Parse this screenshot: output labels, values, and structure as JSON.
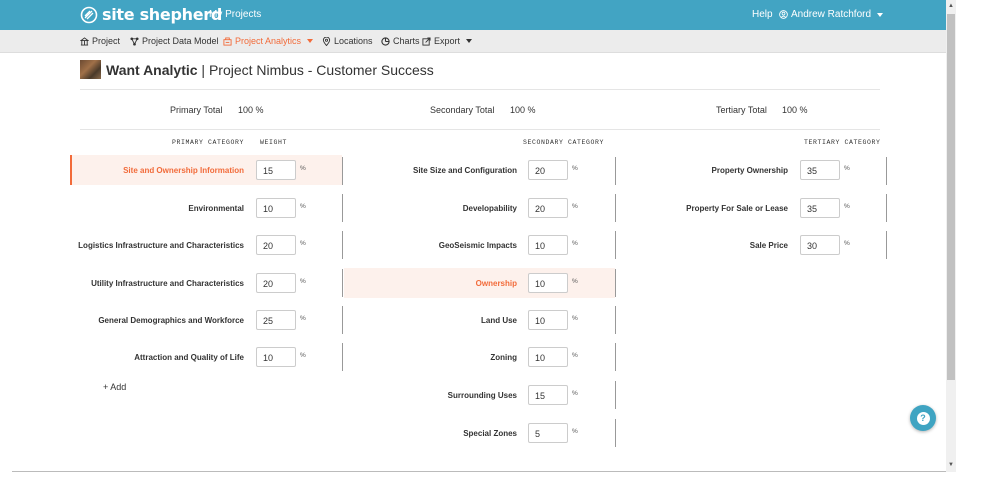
{
  "topbar": {
    "brand": "site shepherd",
    "nav_link": "My Projects",
    "help": "Help",
    "user": "Andrew Ratchford"
  },
  "subnav": {
    "items": [
      "Project",
      "Project Data Model",
      "Project Analytics",
      "Locations",
      "Charts",
      "Export"
    ]
  },
  "page": {
    "title_bold": "Want Analytic",
    "title_rest": " | Project Nimbus - Customer Success"
  },
  "totals": {
    "primary_label": "Primary Total",
    "primary_value": "100 %",
    "secondary_label": "Secondary Total",
    "secondary_value": "100 %",
    "tertiary_label": "Tertiary Total",
    "tertiary_value": "100 %"
  },
  "headers": {
    "primary": "PRIMARY CATEGORY",
    "weight": "WEIGHT",
    "secondary": "SECONDARY CATEGORY",
    "tertiary": "TERTIARY CATEGORY"
  },
  "percent_sign": "%",
  "primary": [
    {
      "label": "Site and Ownership Information",
      "value": "15"
    },
    {
      "label": "Environmental",
      "value": "10"
    },
    {
      "label": "Logistics Infrastructure and Characteristics",
      "value": "20"
    },
    {
      "label": "Utility Infrastructure and Characteristics",
      "value": "20"
    },
    {
      "label": "General Demographics and Workforce",
      "value": "25"
    },
    {
      "label": "Attraction and Quality of Life",
      "value": "10"
    }
  ],
  "secondary": [
    {
      "label": "Site Size and Configuration",
      "value": "20"
    },
    {
      "label": "Developability",
      "value": "20"
    },
    {
      "label": "GeoSeismic Impacts",
      "value": "10"
    },
    {
      "label": "Ownership",
      "value": "10"
    },
    {
      "label": "Land Use",
      "value": "10"
    },
    {
      "label": "Zoning",
      "value": "10"
    },
    {
      "label": "Surrounding Uses",
      "value": "15"
    },
    {
      "label": "Special Zones",
      "value": "5"
    }
  ],
  "tertiary": [
    {
      "label": "Property Ownership",
      "value": "35"
    },
    {
      "label": "Property For Sale or Lease",
      "value": "35"
    },
    {
      "label": "Sale Price",
      "value": "30"
    }
  ],
  "add_label": "+ Add",
  "colors": {
    "topbar": "#42a4c3",
    "accent": "#f26b3a",
    "highlight_bg": "#fdf1ec"
  },
  "icons": [
    "site-shepherd-logo-icon",
    "user-circle-icon",
    "project-icon",
    "data-model-icon",
    "analytics-icon",
    "location-pin-icon",
    "charts-icon",
    "export-icon",
    "help-icon"
  ]
}
